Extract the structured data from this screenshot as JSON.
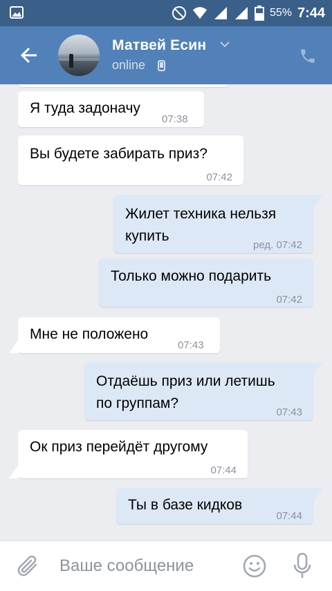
{
  "status_bar": {
    "battery": "55%",
    "time": "7:44",
    "icons": [
      "gallery-icon",
      "do-not-disturb-icon",
      "wifi-icon",
      "signal-icon",
      "signal-icon",
      "battery-icon"
    ]
  },
  "header": {
    "name": "Матвей Есин",
    "status": "online",
    "icons": [
      "back-arrow-icon",
      "chevron-down-icon",
      "mobile-device-icon",
      "phone-icon"
    ]
  },
  "messages": [
    {
      "dir": "in",
      "text": "Я туда задоначу",
      "time": "07:38"
    },
    {
      "dir": "in",
      "text": "Вы будете забирать приз?",
      "time": "07:42"
    },
    {
      "dir": "out",
      "text": "Жилет техника нельзя\nкупить",
      "time": "ред. 07:42"
    },
    {
      "dir": "out",
      "text": "Только можно подарить",
      "time": "07:42"
    },
    {
      "dir": "in",
      "text": "Мне не положено",
      "time": "07:43"
    },
    {
      "dir": "out",
      "text": "Отдаёшь приз или летишь\nпо группам?",
      "time": "07:43"
    },
    {
      "dir": "in",
      "text": "Ок приз перейдёт другому",
      "time": "07:44"
    },
    {
      "dir": "out",
      "text": "Ты в базе кидков",
      "time": "07:44"
    }
  ],
  "input": {
    "placeholder": "Ваше сообщение",
    "icons": [
      "paperclip-icon",
      "emoji-icon",
      "microphone-icon"
    ]
  },
  "colors": {
    "status_bar": "#3a5f88",
    "header": "#5181b8",
    "chat_bg": "#ebedf0",
    "incoming_bubble": "#ffffff",
    "outgoing_bubble": "#dde8f7",
    "timestamp": "#8a929c"
  }
}
